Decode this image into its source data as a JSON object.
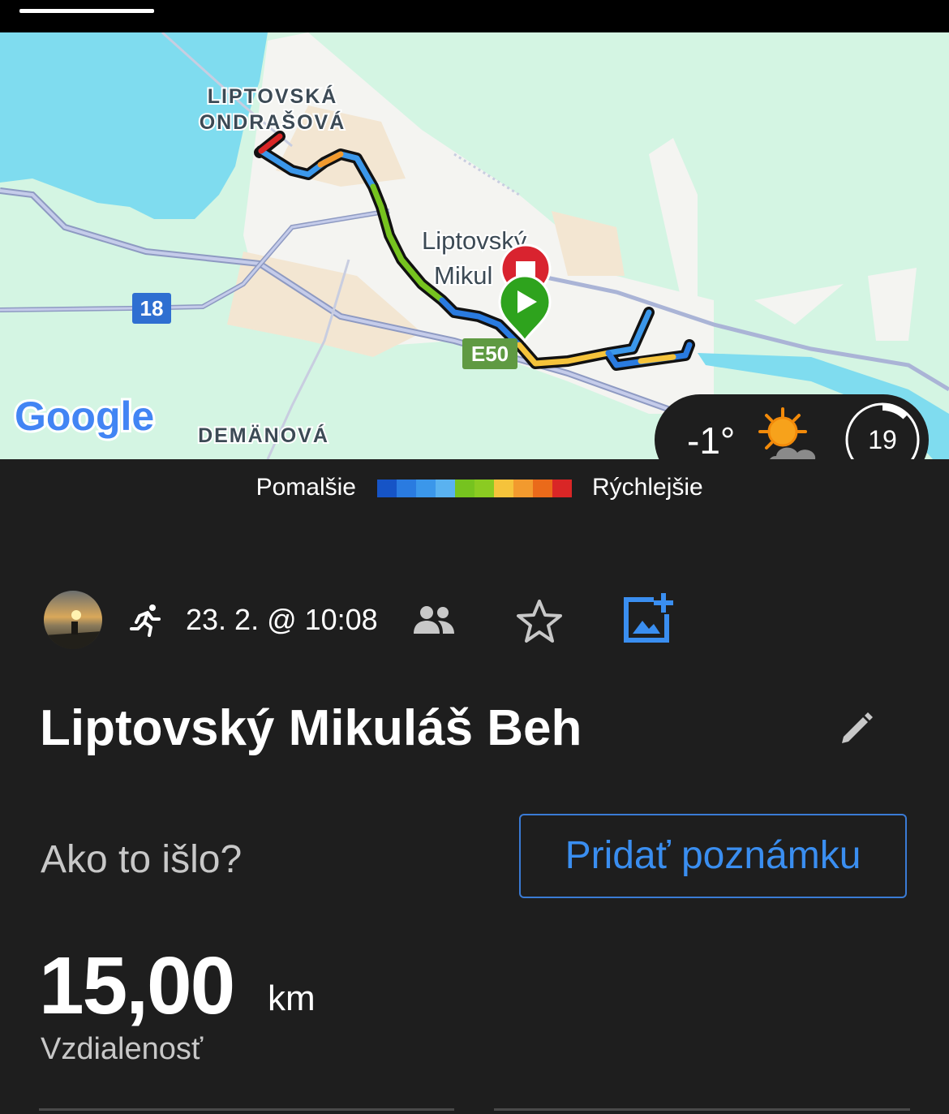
{
  "map": {
    "labels": {
      "town_north_line1": "LIPTOVSKÁ",
      "town_north_line2": "ONDRAŠOVÁ",
      "city_line1": "Liptovský",
      "city_line2": "Mikul",
      "town_south": "DEMÄNOVÁ",
      "road_18": "18",
      "road_e50": "E50",
      "provider": "Google"
    },
    "weather": {
      "temperature": "-1°",
      "icon": "partly-cloudy-sun-icon",
      "timer": "19"
    }
  },
  "legend": {
    "slow_label": "Pomalšie",
    "fast_label": "Rýchlejšie",
    "colors": [
      "#1654c6",
      "#2a7be0",
      "#3b97ea",
      "#5ab2f0",
      "#76c31f",
      "#8bcb22",
      "#f5c33b",
      "#f29a2e",
      "#ea6a1a",
      "#d92626"
    ]
  },
  "activity": {
    "date_time": "23. 2. @ 10:08",
    "title": "Liptovský Mikuláš Beh",
    "prompt": "Ako to išlo?",
    "add_note_label": "Pridať poznámku",
    "distance_value": "15,00",
    "distance_unit": "km",
    "distance_label": "Vzdialenosť"
  },
  "icons": {
    "avatar": "avatar",
    "run": "running-icon",
    "people": "people-icon",
    "star": "star-icon",
    "add_photo": "add-photo-icon",
    "edit": "pencil-icon"
  }
}
